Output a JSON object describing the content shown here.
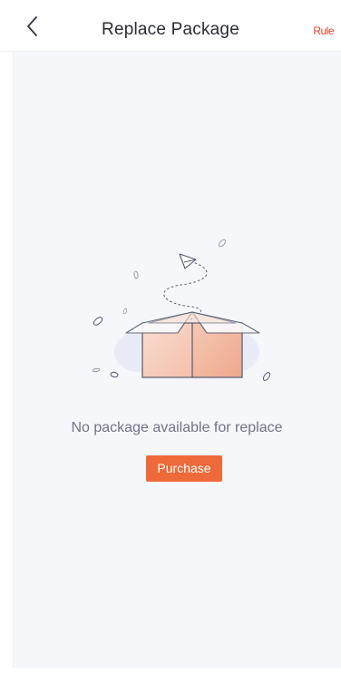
{
  "navbar": {
    "title": "Replace Package",
    "rule_label": "Rule",
    "back_icon": "chevron-left-icon"
  },
  "empty_state": {
    "message": "No package available for replace",
    "illustration": "empty-box-illustration",
    "button_label": "Purchase"
  },
  "colors": {
    "accent": "#ee6a3a",
    "rule_link": "#e8412c",
    "title_text": "#2b2d33",
    "muted_text": "#6f7487",
    "background": "#f6f7fb"
  }
}
